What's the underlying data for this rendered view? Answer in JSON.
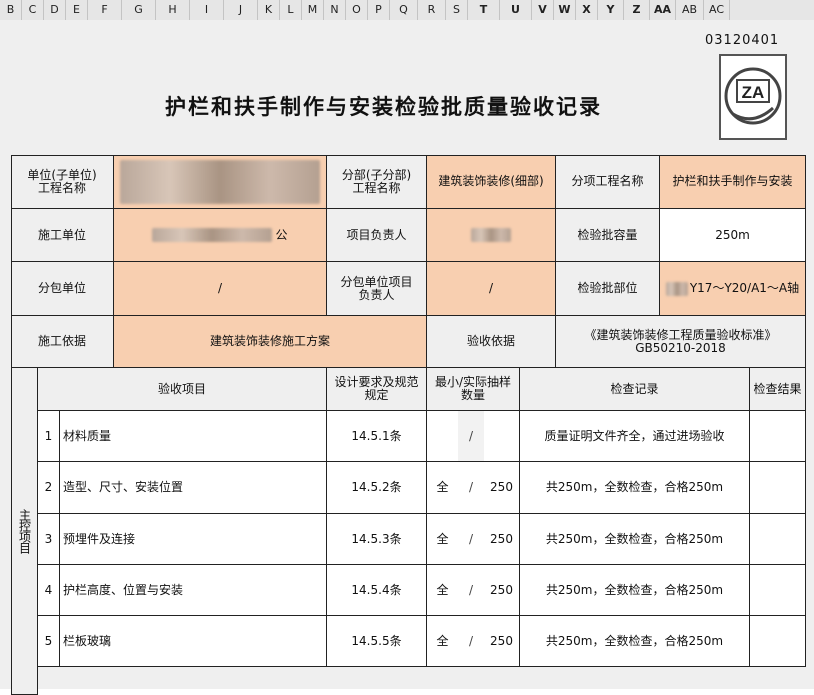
{
  "column_headers": [
    "B",
    "C",
    "D",
    "E",
    "F",
    "G",
    "H",
    "I",
    "J",
    "K",
    "L",
    "M",
    "N",
    "O",
    "P",
    "Q",
    "R",
    "S",
    "T",
    "U",
    "V",
    "W",
    "X",
    "Y",
    "Z",
    "AA",
    "AB",
    "AC"
  ],
  "form": {
    "code": "03120401",
    "title": "护栏和扶手制作与安装检验批质量验收记录",
    "logo_text": "ZA"
  },
  "header_rows": {
    "unit_project_label": "单位(子单位)\n工程名称",
    "unit_project_value": "",
    "division_label": "分部(子分部)\n工程名称",
    "division_value": "建筑装饰装修(细部)",
    "subitem_label": "分项工程名称",
    "subitem_value": "护栏和扶手制作与安装",
    "construction_unit_label": "施工单位",
    "construction_unit_value": "公",
    "project_manager_label": "项目负责人",
    "project_manager_value": "",
    "batch_capacity_label": "检验批容量",
    "batch_capacity_value": "250m",
    "subcontractor_label": "分包单位",
    "subcontractor_value": "/",
    "sub_manager_label": "分包单位项目\n负责人",
    "sub_manager_value": "/",
    "batch_location_label": "检验批部位",
    "batch_location_value": "Y17～Y20/A1～A轴",
    "construction_basis_label": "施工依据",
    "construction_basis_value": "建筑装饰装修施工方案",
    "acceptance_basis_label": "验收依据",
    "acceptance_basis_value": "《建筑装饰装修工程质量验收标准》GB50210-2018"
  },
  "items_header": {
    "item": "验收项目",
    "design": "设计要求及规范规定",
    "sample": "最小/实际抽样数量",
    "record": "检查记录",
    "result": "检查结果"
  },
  "main_control_label": "主控项目",
  "items": [
    {
      "no": "1",
      "name": "材料质量",
      "clause": "14.5.1条",
      "min": "",
      "slash": "/",
      "actual": "",
      "record": "质量证明文件齐全，通过进场验收",
      "result": ""
    },
    {
      "no": "2",
      "name": "造型、尺寸、安装位置",
      "clause": "14.5.2条",
      "min": "全",
      "slash": "/",
      "actual": "250",
      "record": "共250m，全数检查，合格250m",
      "result": ""
    },
    {
      "no": "3",
      "name": "预埋件及连接",
      "clause": "14.5.3条",
      "min": "全",
      "slash": "/",
      "actual": "250",
      "record": "共250m，全数检查，合格250m",
      "result": ""
    },
    {
      "no": "4",
      "name": "护栏高度、位置与安装",
      "clause": "14.5.4条",
      "min": "全",
      "slash": "/",
      "actual": "250",
      "record": "共250m，全数检查，合格250m",
      "result": ""
    },
    {
      "no": "5",
      "name": "栏板玻璃",
      "clause": "14.5.5条",
      "min": "全",
      "slash": "/",
      "actual": "250",
      "record": "共250m，全数检查，合格250m",
      "result": ""
    }
  ]
}
